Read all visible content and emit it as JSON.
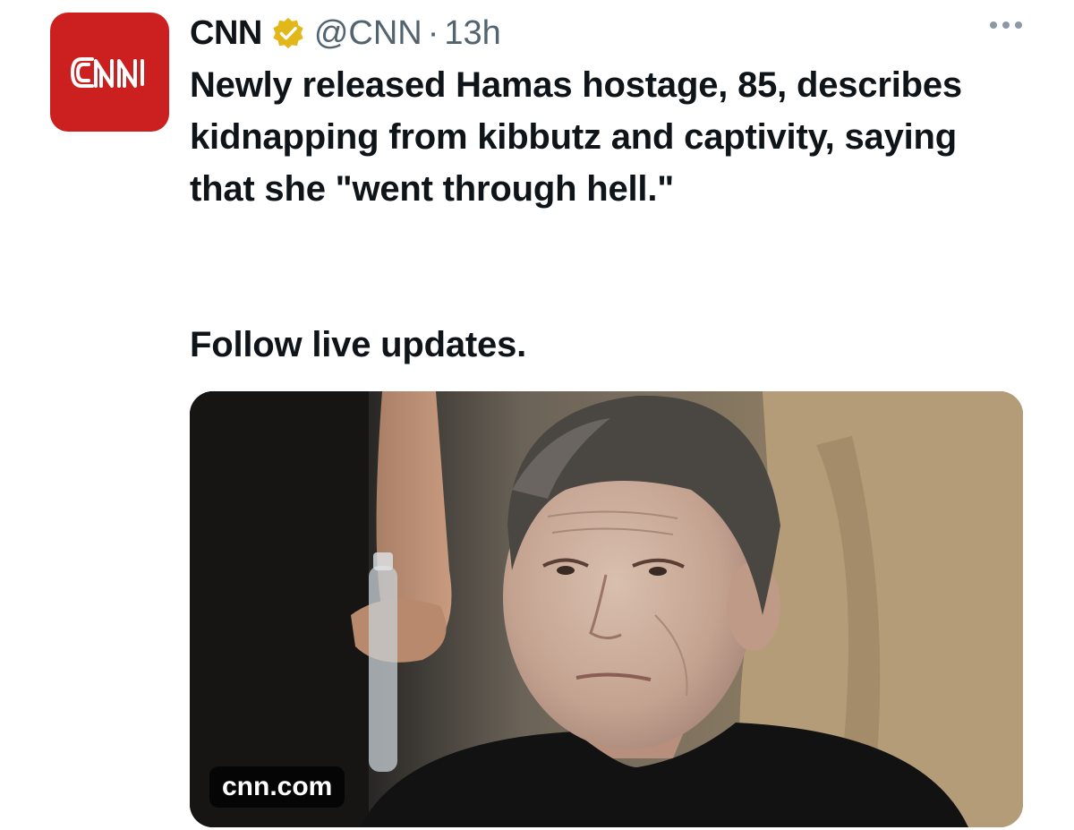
{
  "author": {
    "name": "CNN",
    "handle": "@CNN",
    "separator": "·",
    "time": "13h",
    "avatar_text": "CNN",
    "avatar_color": "#cc1f1f",
    "verified_badge_color": "#e2b719"
  },
  "tweet": {
    "text": "Newly released Hamas hostage, 85, describes kidnapping from kibbutz and captivity, saying that she \"went through hell.\"",
    "follow_link": "Follow live updates."
  },
  "card": {
    "domain": "cnn.com",
    "image_icon": "photo-of-elderly-woman"
  },
  "icons": {
    "more": "more-options-icon",
    "verified": "verified-badge-icon"
  }
}
